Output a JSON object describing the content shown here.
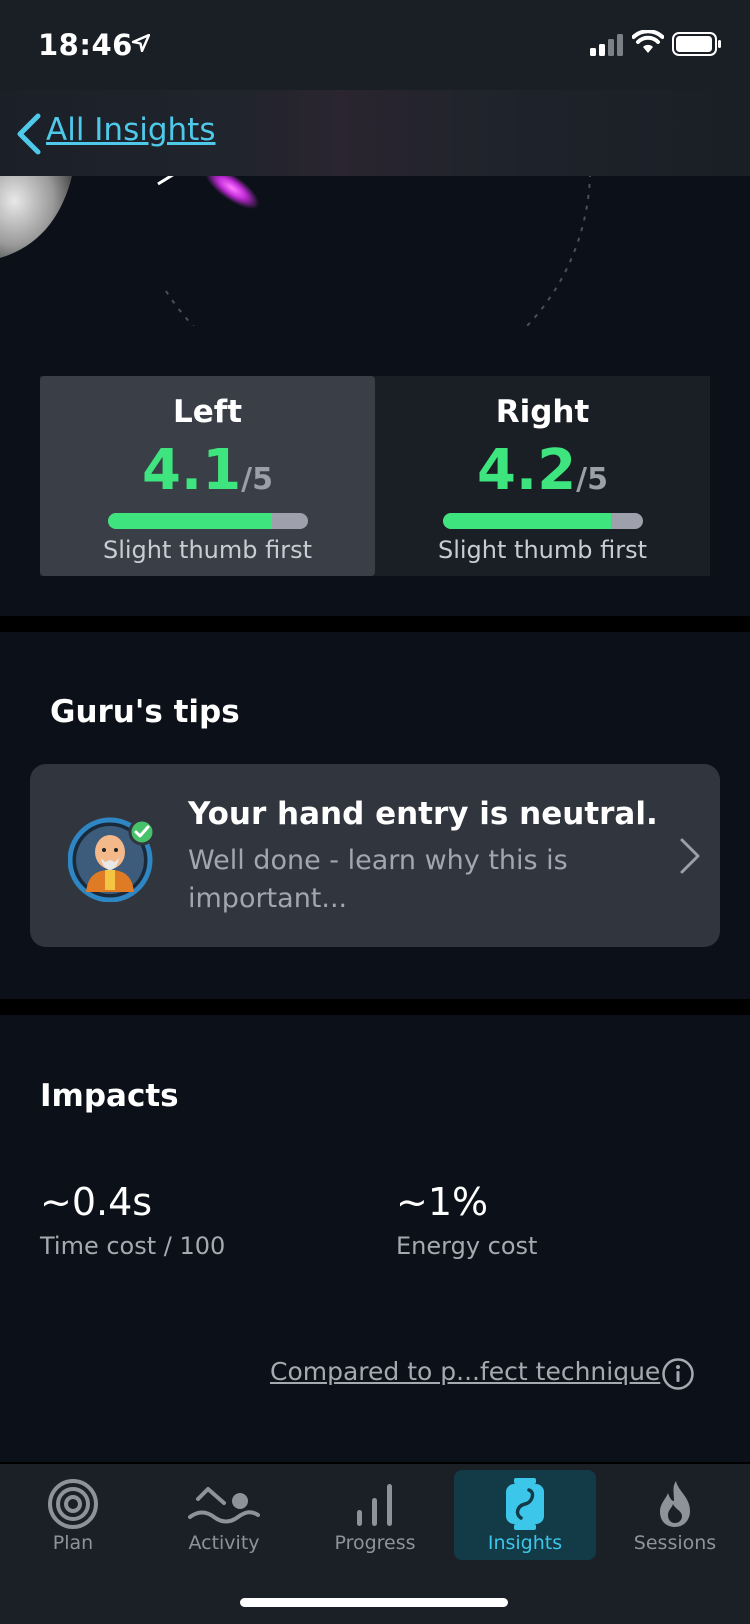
{
  "status_bar": {
    "time": "18:46"
  },
  "nav": {
    "back_label": "All Insights"
  },
  "scores": [
    {
      "side": "Left",
      "value": "4.1",
      "max": "/5",
      "fill_fraction": 0.82,
      "note": "Slight thumb first"
    },
    {
      "side": "Right",
      "value": "4.2",
      "max": "/5",
      "fill_fraction": 0.84,
      "note": "Slight thumb first"
    }
  ],
  "tips": {
    "title": "Guru's tips",
    "heading": "Your hand entry is neutral.",
    "body": "Well done - learn why this is important..."
  },
  "impacts": {
    "title": "Impacts",
    "items": [
      {
        "value": "~0.4s",
        "label": "Time cost / 100"
      },
      {
        "value": "~1%",
        "label": "Energy cost"
      }
    ],
    "compare_link": "Compared to p...fect technique"
  },
  "tabs": [
    {
      "label": "Plan",
      "icon": "target-icon"
    },
    {
      "label": "Activity",
      "icon": "swimmer-icon"
    },
    {
      "label": "Progress",
      "icon": "bar-chart-icon"
    },
    {
      "label": "Insights",
      "icon": "watch-icon",
      "active": true
    },
    {
      "label": "Sessions",
      "icon": "flame-icon"
    }
  ],
  "colors": {
    "accent": "#3cc7ea",
    "score_green": "#3ee57f",
    "background": "#0c1119"
  }
}
